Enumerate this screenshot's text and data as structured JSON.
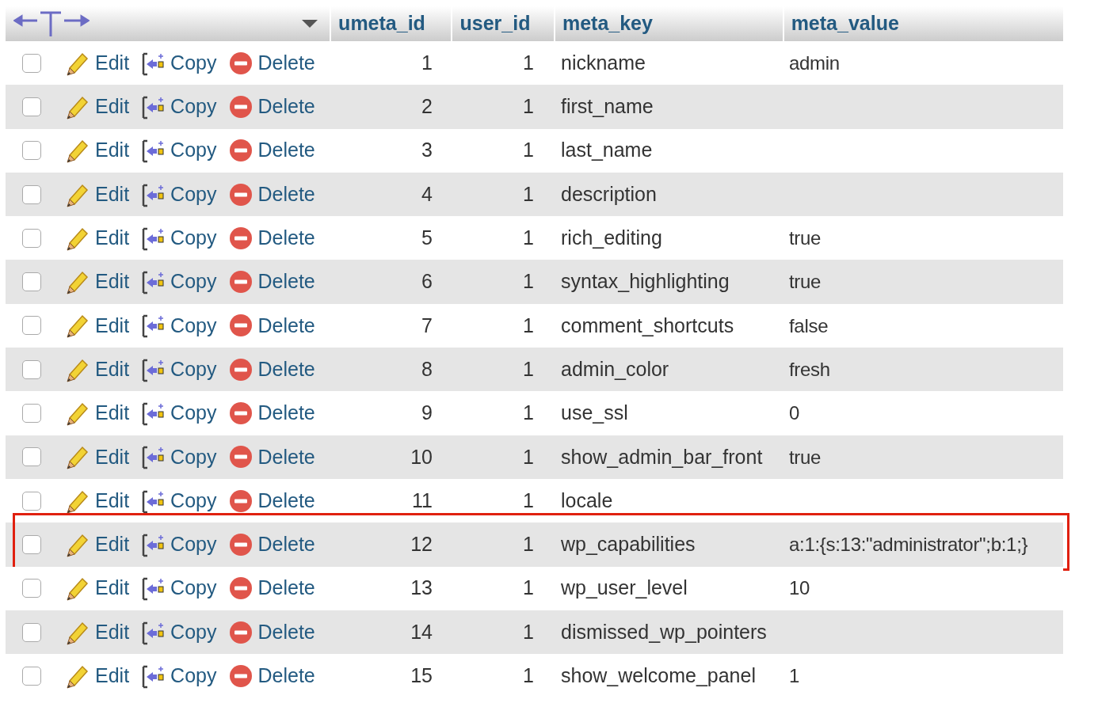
{
  "table": {
    "columns": [
      "umeta_id",
      "user_id",
      "meta_key",
      "meta_value"
    ],
    "rows": [
      {
        "actions": [
          "Edit",
          "Copy",
          "Delete"
        ],
        "umeta_id": "1",
        "user_id": "1",
        "meta_key": "nickname",
        "meta_value": "admin",
        "checked": false,
        "highlighted": false
      },
      {
        "actions": [
          "Edit",
          "Copy",
          "Delete"
        ],
        "umeta_id": "2",
        "user_id": "1",
        "meta_key": "first_name",
        "checked": false,
        "highlighted": false
      },
      {
        "actions": [
          "Edit",
          "Copy",
          "Delete"
        ],
        "umeta_id": "3",
        "user_id": "1",
        "meta_key": "last_name",
        "checked": false,
        "highlighted": false
      },
      {
        "actions": [
          "Edit",
          "Copy",
          "Delete"
        ],
        "umeta_id": "4",
        "user_id": "1",
        "meta_key": "description",
        "checked": false,
        "highlighted": false
      },
      {
        "actions": [
          "Edit",
          "Copy",
          "Delete"
        ],
        "umeta_id": "5",
        "user_id": "1",
        "meta_key": "rich_editing",
        "meta_value": "true",
        "checked": false,
        "highlighted": false
      },
      {
        "actions": [
          "Edit",
          "Copy",
          "Delete"
        ],
        "umeta_id": "6",
        "user_id": "1",
        "meta_key": "syntax_highlighting",
        "meta_value": "true",
        "checked": false,
        "highlighted": false
      },
      {
        "actions": [
          "Edit",
          "Copy",
          "Delete"
        ],
        "umeta_id": "7",
        "user_id": "1",
        "meta_key": "comment_shortcuts",
        "meta_value": "false",
        "checked": false,
        "highlighted": false
      },
      {
        "actions": [
          "Edit",
          "Copy",
          "Delete"
        ],
        "umeta_id": "8",
        "user_id": "1",
        "meta_key": "admin_color",
        "meta_value": "fresh",
        "checked": false,
        "highlighted": false
      },
      {
        "actions": [
          "Edit",
          "Copy",
          "Delete"
        ],
        "umeta_id": "9",
        "user_id": "1",
        "meta_key": "use_ssl",
        "meta_value": "0",
        "checked": false,
        "highlighted": false
      },
      {
        "actions": [
          "Edit",
          "Copy",
          "Delete"
        ],
        "umeta_id": "10",
        "user_id": "1",
        "meta_key": "show_admin_bar_front",
        "meta_value": "true",
        "checked": false,
        "highlighted": false
      },
      {
        "actions": [
          "Edit",
          "Copy",
          "Delete"
        ],
        "umeta_id": "11",
        "user_id": "1",
        "meta_key": "locale",
        "checked": false,
        "highlighted": false
      },
      {
        "actions": [
          "Edit",
          "Copy",
          "Delete"
        ],
        "umeta_id": "12",
        "user_id": "1",
        "meta_key": "wp_capabilities",
        "meta_value": "a:1:{s:13:\"administrator\";b:1;}",
        "checked": false,
        "highlighted": true
      },
      {
        "actions": [
          "Edit",
          "Copy",
          "Delete"
        ],
        "umeta_id": "13",
        "user_id": "1",
        "meta_key": "wp_user_level",
        "meta_value": "10",
        "checked": false,
        "highlighted": false
      },
      {
        "actions": [
          "Edit",
          "Copy",
          "Delete"
        ],
        "umeta_id": "14",
        "user_id": "1",
        "meta_key": "dismissed_wp_pointers",
        "checked": false,
        "highlighted": false
      },
      {
        "actions": [
          "Edit",
          "Copy",
          "Delete"
        ],
        "umeta_id": "15",
        "user_id": "1",
        "meta_key": "show_welcome_panel",
        "meta_value": "1",
        "checked": false,
        "highlighted": false
      }
    ]
  }
}
